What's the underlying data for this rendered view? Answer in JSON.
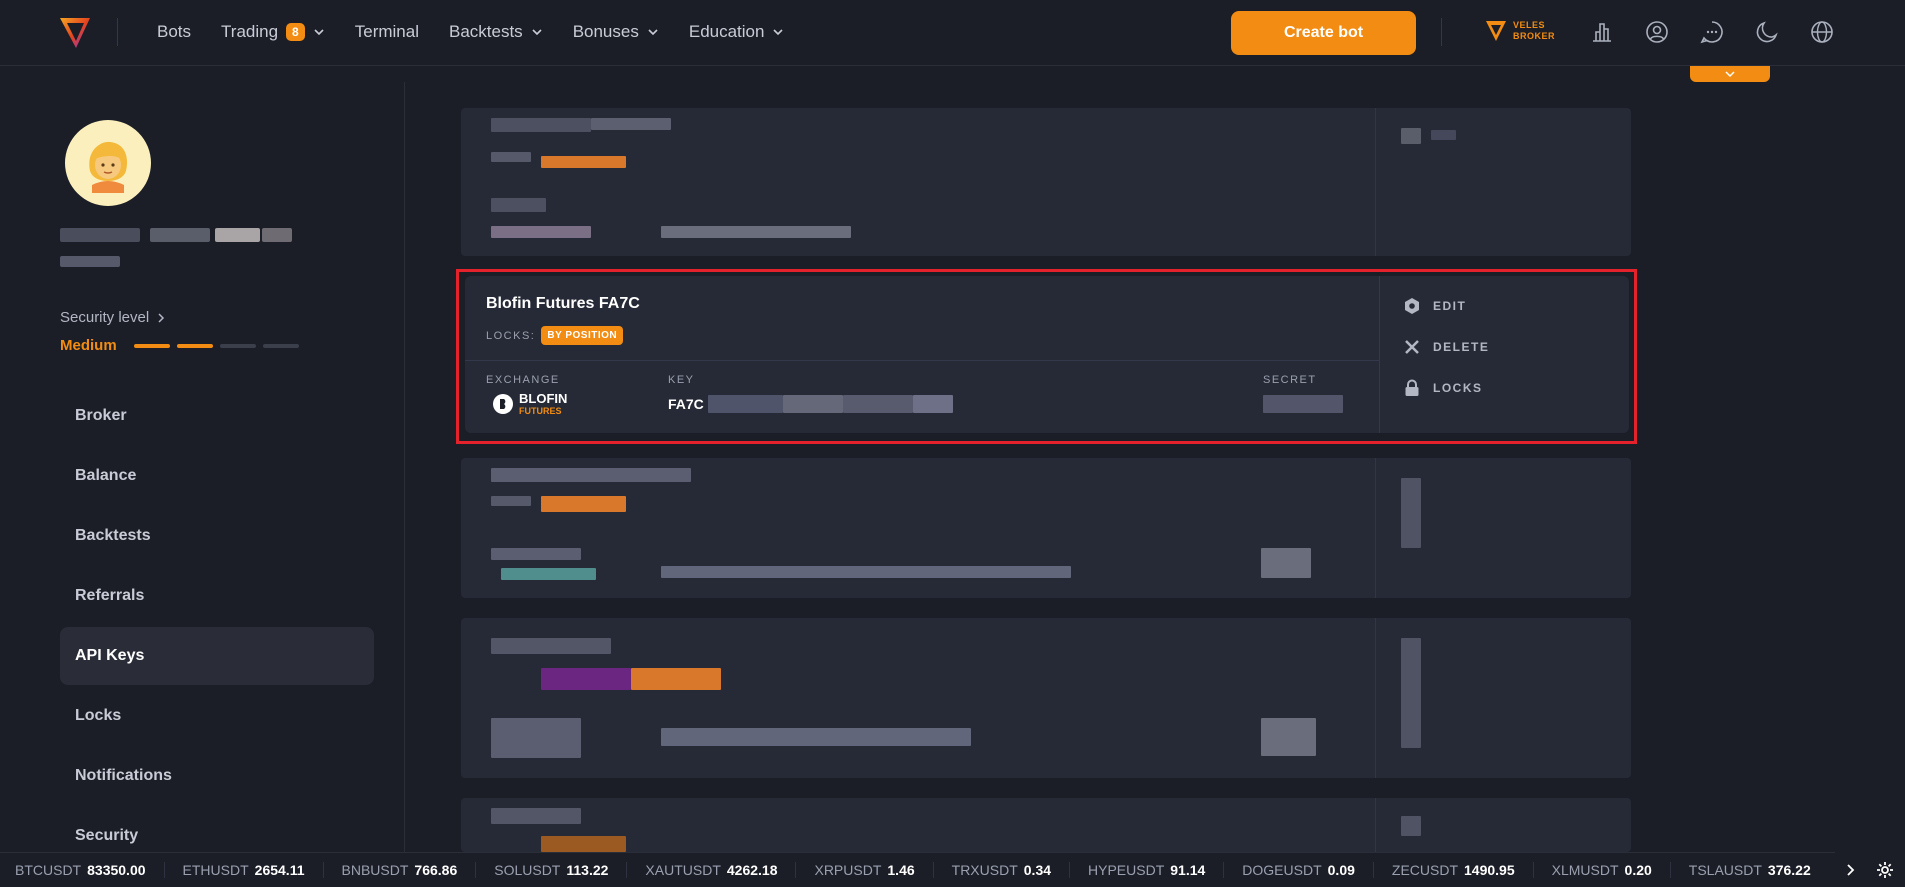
{
  "nav": {
    "items": [
      {
        "label": "Bots",
        "has_chevron": false
      },
      {
        "label": "Trading",
        "badge": "8",
        "has_chevron": true
      },
      {
        "label": "Terminal",
        "has_chevron": false
      },
      {
        "label": "Backtests",
        "has_chevron": true
      },
      {
        "label": "Bonuses",
        "has_chevron": true
      },
      {
        "label": "Education",
        "has_chevron": true
      }
    ],
    "create_bot": "Create bot",
    "broker": {
      "line1": "VELES",
      "line2": "BROKER"
    },
    "icons": [
      "bar-chart-icon",
      "user-circle-icon",
      "chat-icon",
      "moon-icon",
      "globe-icon"
    ]
  },
  "profile": {
    "security_label": "Security level",
    "security_value": "Medium",
    "security_level": 2,
    "security_max": 4
  },
  "menu": [
    {
      "label": "Broker",
      "active": false
    },
    {
      "label": "Balance",
      "active": false
    },
    {
      "label": "Backtests",
      "active": false
    },
    {
      "label": "Referrals",
      "active": false
    },
    {
      "label": "API Keys",
      "active": true
    },
    {
      "label": "Locks",
      "active": false
    },
    {
      "label": "Notifications",
      "active": false
    },
    {
      "label": "Security",
      "active": false
    }
  ],
  "api_card": {
    "title": "Blofin Futures FA7C",
    "locks_label": "LOCKS:",
    "lock_badge": "BY POSITION",
    "exchange_label": "EXCHANGE",
    "exchange_name": "BLOFIN",
    "exchange_sub": "FUTURES",
    "key_label": "KEY",
    "key_value": "FA7C",
    "secret_label": "SECRET",
    "actions": {
      "edit": "EDIT",
      "delete": "DELETE",
      "locks": "LOCKS"
    }
  },
  "ticker": [
    {
      "symbol": "BTCUSDT",
      "value": "83350.00"
    },
    {
      "symbol": "ETHUSDT",
      "value": "2654.11"
    },
    {
      "symbol": "BNBUSDT",
      "value": "766.86"
    },
    {
      "symbol": "SOLUSDT",
      "value": "113.22"
    },
    {
      "symbol": "XAUTUSDT",
      "value": "4262.18"
    },
    {
      "symbol": "XRPUSDT",
      "value": "1.46"
    },
    {
      "symbol": "TRXUSDT",
      "value": "0.34"
    },
    {
      "symbol": "HYPEUSDT",
      "value": "91.14"
    },
    {
      "symbol": "DOGEUSDT",
      "value": "0.09"
    },
    {
      "symbol": "ZECUSDT",
      "value": "1490.95"
    },
    {
      "symbol": "XLMUSDT",
      "value": "0.20"
    },
    {
      "symbol": "TSLAUSDT",
      "value": "376.22"
    }
  ],
  "colors": {
    "accent": "#f28c12",
    "highlight": "#e3222b",
    "background": "#1b1e27",
    "card": "#262a36"
  }
}
